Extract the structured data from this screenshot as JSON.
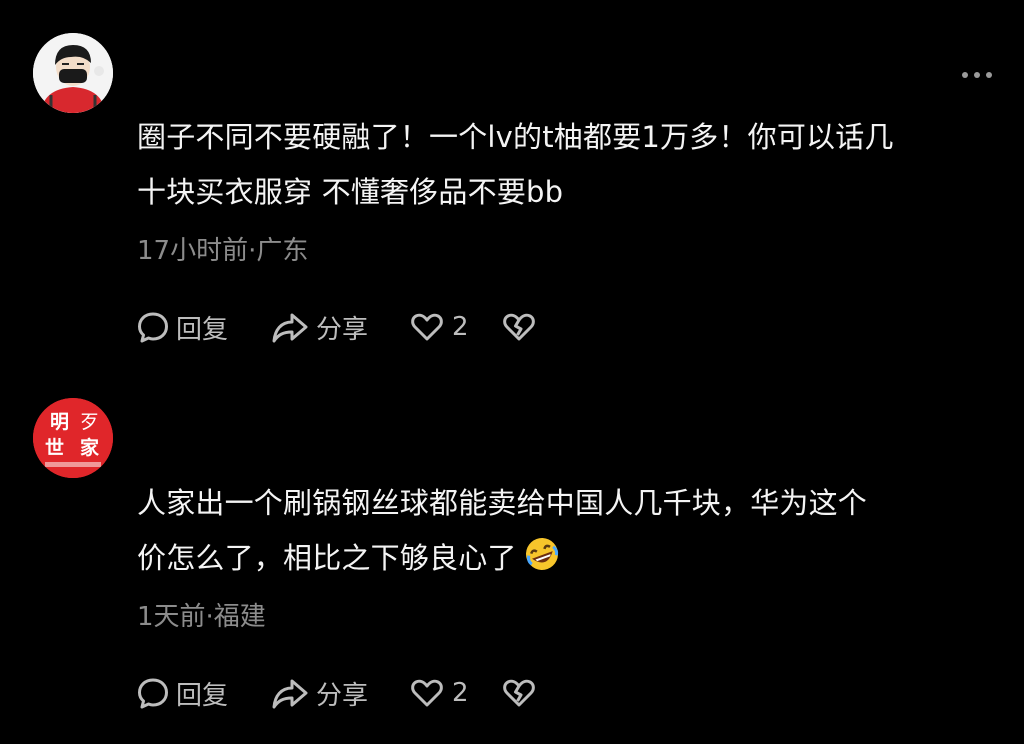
{
  "comments": [
    {
      "avatar_icon": "boy-with-mask-avatar-icon",
      "text_line1": "圈子不同不要硬融了！一个lv的t柚都要1万多！你可以话几",
      "text_line2": "十块买衣服穿 不懂奢侈品不要bb",
      "meta": "17小时前·广东",
      "reply_label": "回复",
      "share_label": "分享",
      "like_count": "2"
    },
    {
      "avatar_icon": "calligraphy-seal-avatar-icon",
      "avatar_text": [
        "明",
        "世",
        "家"
      ],
      "text_line1": "人家出一个刷锅钢丝球都能卖给中国人几千块，华为这个",
      "text_line2": "价怎么了，相比之下够良心了",
      "emoji": "rolling-laughing-emoji-icon",
      "meta": "1天前·福建",
      "reply_label": "回复",
      "share_label": "分享",
      "like_count": "2"
    }
  ],
  "colors": {
    "background": "#000000",
    "text": "#f4f4f4",
    "meta": "#8c8c8c",
    "icon": "#bdbdbd",
    "avatar2_red": "#e0262a"
  }
}
